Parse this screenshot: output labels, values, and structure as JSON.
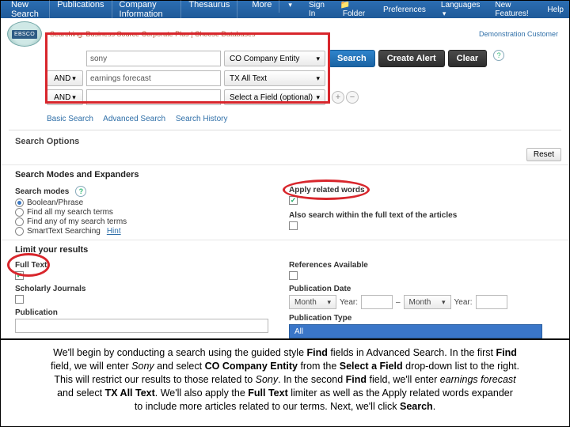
{
  "topnav": {
    "items": [
      "New Search",
      "Publications",
      "Company Information",
      "Thesaurus",
      "More"
    ],
    "right": [
      "Sign In",
      "Folder",
      "Preferences",
      "Languages",
      "New Features!",
      "Help"
    ]
  },
  "logo": "EBSCO",
  "crumbs": "Searching: Business Source Corporate Plus | Choose Databases",
  "demo_customer": "Demonstration Customer",
  "search": {
    "row1": {
      "term": "sony",
      "field": "CO Company Entity"
    },
    "row2": {
      "bool": "AND",
      "term": "earnings forecast",
      "field": "TX All Text"
    },
    "row3": {
      "bool": "AND",
      "term": "",
      "field": "Select a Field (optional)"
    },
    "buttons": {
      "search": "Search",
      "alert": "Create Alert",
      "clear": "Clear"
    },
    "links": {
      "basic": "Basic Search",
      "advanced": "Advanced Search",
      "history": "Search History"
    }
  },
  "sections": {
    "options": "Search Options",
    "reset": "Reset",
    "modes": "Search Modes and Expanders",
    "limit": "Limit your results"
  },
  "modes": {
    "label": "Search modes",
    "o1": "Boolean/Phrase",
    "o2": "Find all my search terms",
    "o3": "Find any of my search terms",
    "o4": "SmartText Searching",
    "hint": "Hint",
    "apply": "Apply related words",
    "fulltext_search": "Also search within the full text of the articles"
  },
  "limits": {
    "fulltext": "Full Text",
    "scholarly": "Scholarly Journals",
    "publication": "Publication",
    "refs": "References Available",
    "pubdate": "Publication Date",
    "month": "Month",
    "year": "Year:",
    "pubtype": "Publication Type",
    "pubtype_val": "All"
  },
  "caption": {
    "l1a": "We'll begin by conducting a search using the guided style ",
    "l1b": " fields in Advanced Search. In the first ",
    "l2a": "field, we will enter ",
    "l2b": " and select ",
    "l2c": " from the ",
    "l2d": " drop-down list to the right.",
    "l3a": "This will restrict our results to those related to ",
    "l3b": ". In the second ",
    "l3c": " field, we'll enter ",
    "l4a": "and select ",
    "l4b": ". We'll also apply the ",
    "l4c": " limiter as well as the Apply related words expander",
    "l5": "to include more articles related to our terms. Next, we'll click ",
    "find": "Find",
    "sony": "Sony",
    "co": "CO Company Entity",
    "sel": "Select a Field",
    "ef": "earnings forecast",
    "tx": "TX All Text",
    "ft": "Full Text",
    "search": "Search"
  }
}
